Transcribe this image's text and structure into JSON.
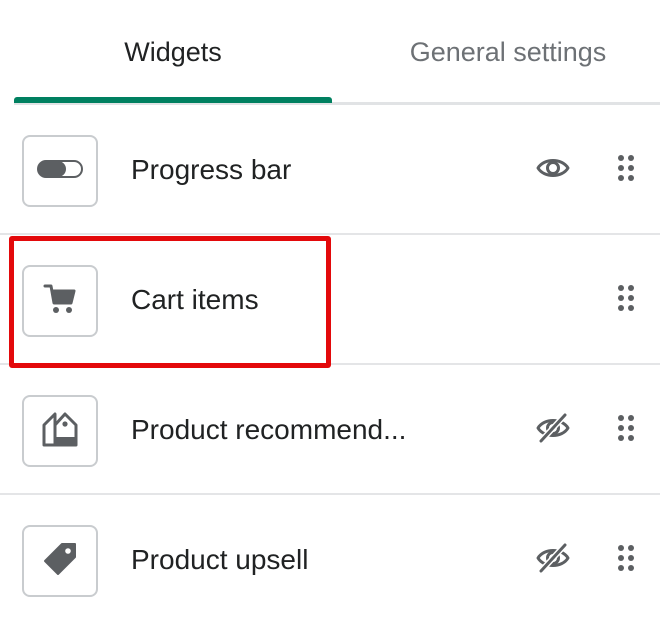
{
  "tabs": [
    {
      "label": "Widgets",
      "active": true
    },
    {
      "label": "General settings",
      "active": false
    }
  ],
  "widgets": [
    {
      "label": "Progress bar",
      "thumb_icon": "toggle-pill-icon",
      "visibility": "visible",
      "visibility_icon": "eye-icon",
      "drag_icon": "drag-handle-icon"
    },
    {
      "label": "Cart items",
      "thumb_icon": "cart-icon",
      "visibility": "none",
      "drag_icon": "drag-handle-icon",
      "highlighted": true
    },
    {
      "label": "Product recommend...",
      "thumb_icon": "product-tags-icon",
      "visibility": "hidden",
      "visibility_icon": "eye-slash-icon",
      "drag_icon": "drag-handle-icon"
    },
    {
      "label": "Product upsell",
      "thumb_icon": "price-tag-icon",
      "visibility": "hidden",
      "visibility_icon": "eye-slash-icon",
      "drag_icon": "drag-handle-icon"
    }
  ],
  "colors": {
    "accent": "#008060",
    "highlight": "#e3090b",
    "text": "#202223",
    "muted_text": "#6d7175",
    "icon": "#5c5f62",
    "border": "#c9cccf"
  }
}
